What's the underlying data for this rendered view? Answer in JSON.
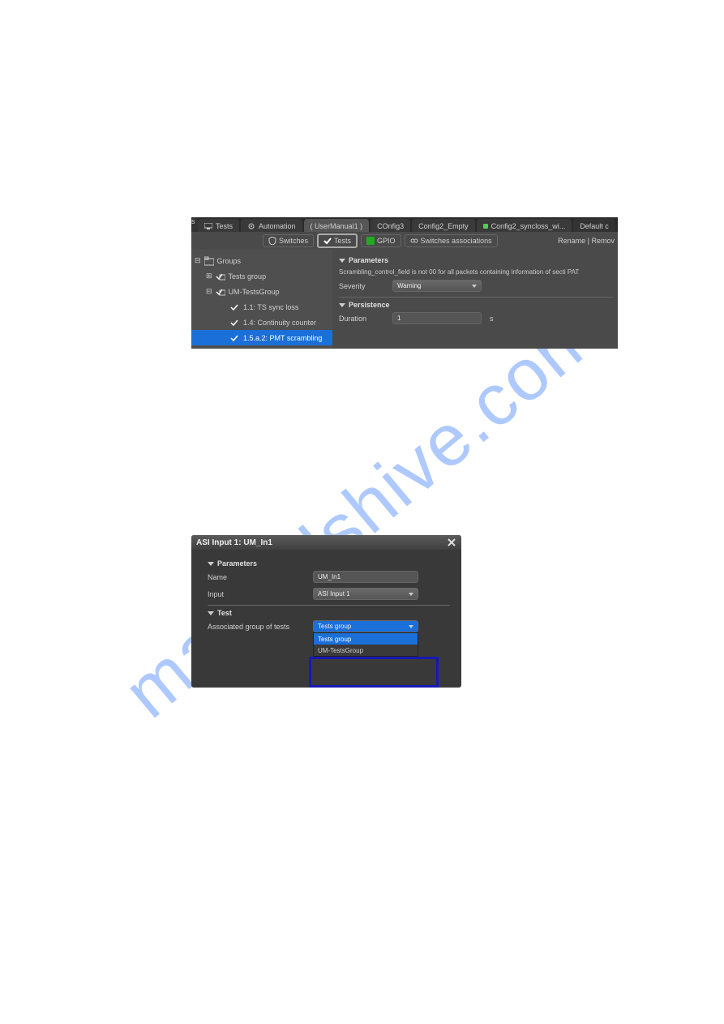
{
  "watermark": "manualshive.com",
  "s1": {
    "tabs": {
      "left_stub": "s",
      "tests": "Tests",
      "automation": "Automation",
      "active": "( UserManual1 )",
      "config3": "COnfig3",
      "config2_empty": "Config2_Empty",
      "config2_syncloss": "Config2_syncloss_wi...",
      "default": "Default c"
    },
    "toolbar": {
      "switches": "Switches",
      "tests": "Tests",
      "gpio": "GPIO",
      "assoc": "Switches associations",
      "rename": "Rename | Remov"
    },
    "tree": {
      "root": "Groups",
      "g1": "Tests group",
      "g2": "UM-TestsGroup",
      "t1": "1.1: TS sync loss",
      "t2": "1.4: Continuity counter",
      "t3": "1.5.a.2: PMT scrambling"
    },
    "params_hdr": "Parameters",
    "desc": "Scrambling_control_field is not 00 for all packets containing information of secti PAT",
    "severity_lbl": "Severity",
    "severity_val": "Warning",
    "persist_hdr": "Persistence",
    "duration_lbl": "Duration",
    "duration_val": "1",
    "duration_unit": "s"
  },
  "s2": {
    "title": "ASI Input 1: UM_In1",
    "params_hdr": "Parameters",
    "name_lbl": "Name",
    "name_val": "UM_In1",
    "input_lbl": "Input",
    "input_val": "ASI Input 1",
    "test_hdr": "Test",
    "assoc_lbl": "Associated group of tests",
    "assoc_val": "Tests group",
    "opt1": "Tests group",
    "opt2": "UM-TestsGroup"
  }
}
